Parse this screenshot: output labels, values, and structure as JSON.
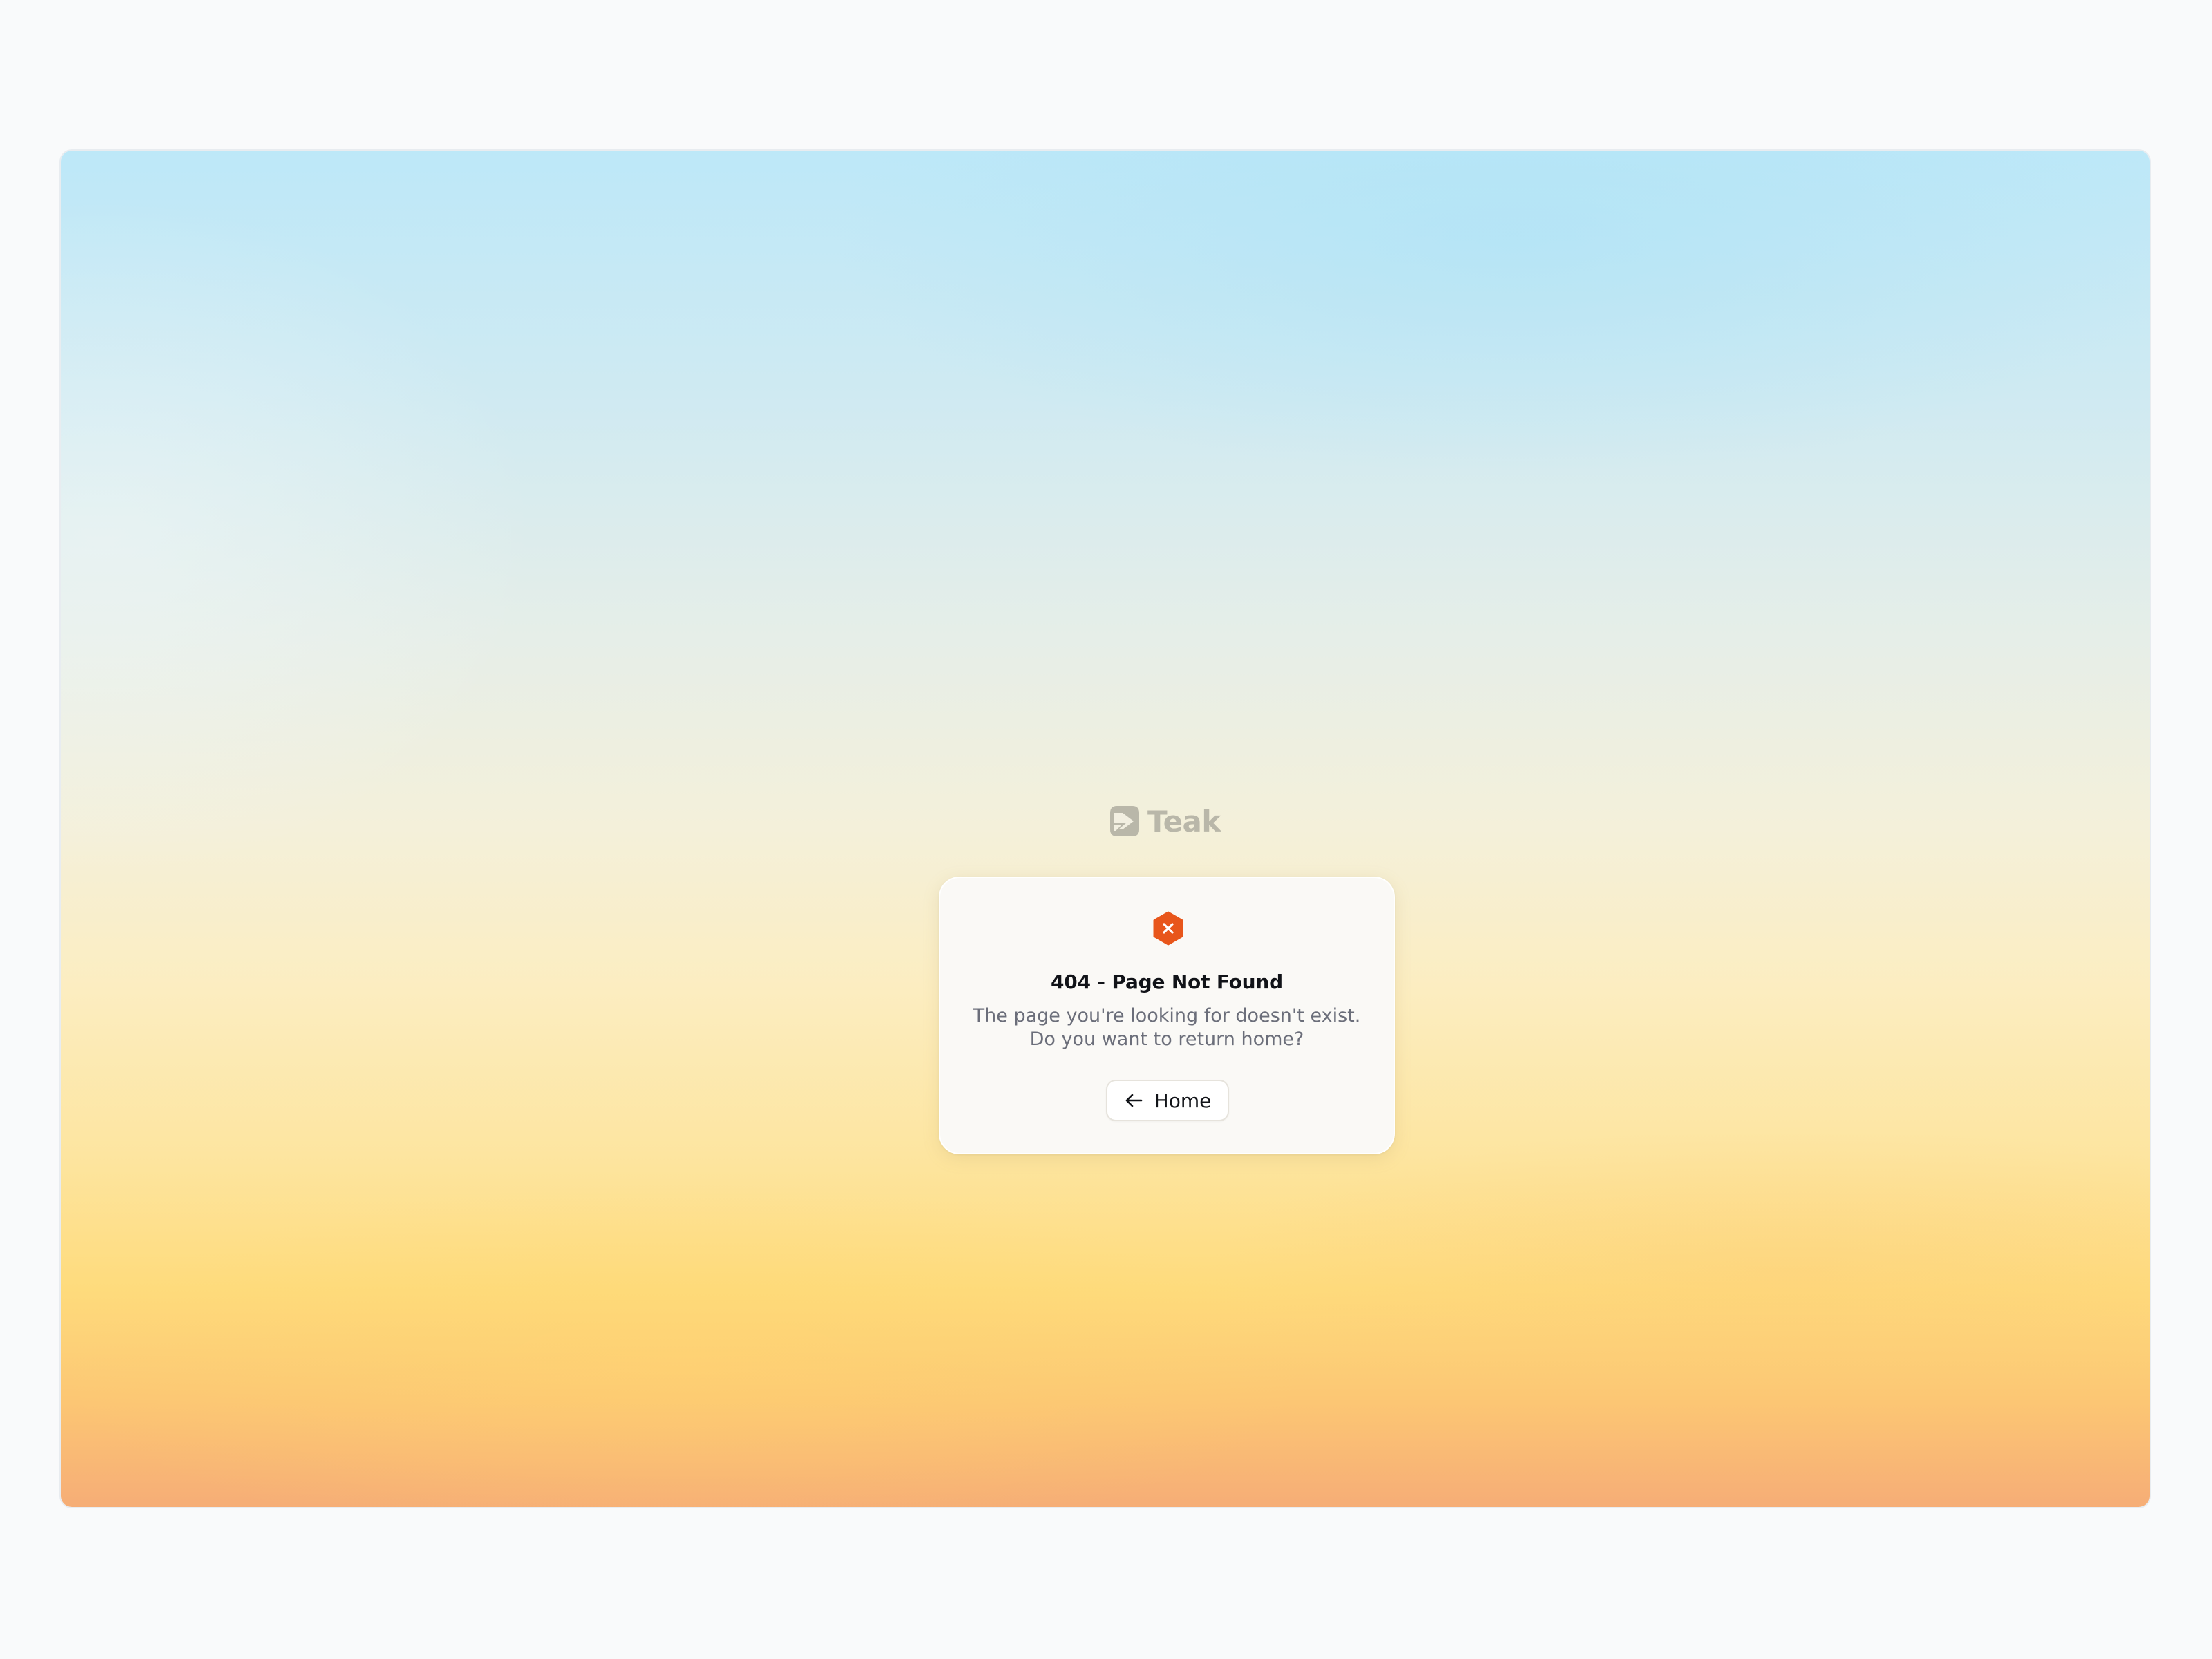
{
  "brand": {
    "logo_icon": "teak-logo-icon",
    "name": "Teak"
  },
  "error": {
    "icon": "error-hexagon-icon",
    "icon_color": "#e8561b",
    "title": "404 - Page Not Found",
    "message_line1": "The page you're looking for doesn't exist.",
    "message_line2": "Do you want to return home?"
  },
  "actions": {
    "home_icon": "arrow-left-icon",
    "home_label": "Home"
  }
}
